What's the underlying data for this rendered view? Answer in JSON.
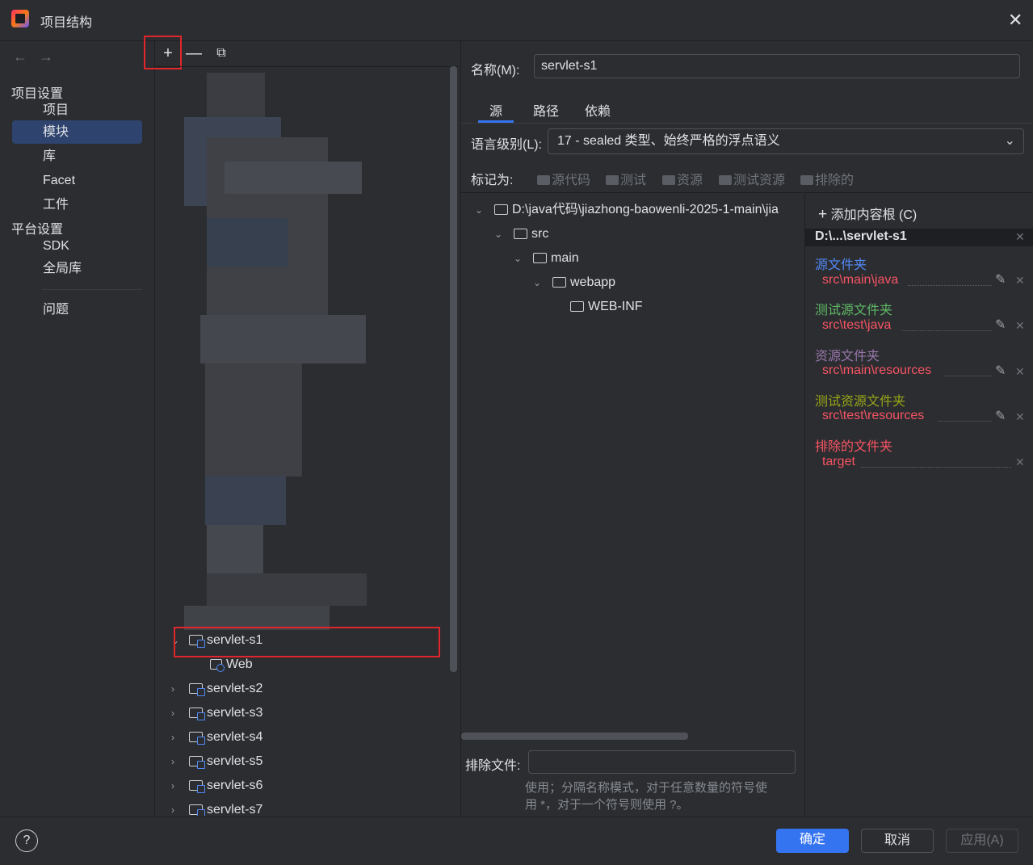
{
  "window": {
    "title": "项目结构"
  },
  "sidebar": {
    "project_settings": "项目设置",
    "items": [
      {
        "label": "项目"
      },
      {
        "label": "模块",
        "selected": true
      },
      {
        "label": "库"
      },
      {
        "label": "Facet"
      },
      {
        "label": "工件"
      }
    ],
    "platform_settings": "平台设置",
    "platform_items": [
      {
        "label": "SDK"
      },
      {
        "label": "全局库"
      }
    ],
    "problems": "问题"
  },
  "tree": {
    "modules": [
      {
        "label": "servlet-s1",
        "expanded": true,
        "selected": true
      },
      {
        "label": "Web",
        "child": true
      },
      {
        "label": "servlet-s2"
      },
      {
        "label": "servlet-s3"
      },
      {
        "label": "servlet-s4"
      },
      {
        "label": "servlet-s5"
      },
      {
        "label": "servlet-s6"
      },
      {
        "label": "servlet-s7"
      }
    ]
  },
  "module": {
    "name_label": "名称(M):",
    "name_value": "servlet-s1",
    "tabs": [
      {
        "label": "源",
        "active": true
      },
      {
        "label": "路径"
      },
      {
        "label": "依赖"
      }
    ],
    "language_label": "语言级别(L):",
    "language_value": "17 - sealed 类型、始终严格的浮点语义",
    "mark_as_label": "标记为:",
    "mark_as": [
      "源代码",
      "测试",
      "资源",
      "测试资源",
      "排除的"
    ],
    "file_tree": [
      {
        "label": "D:\\java代码\\jiazhong-baowenli-2025-1-main\\jia"
      },
      {
        "label": "src"
      },
      {
        "label": "main"
      },
      {
        "label": "webapp"
      },
      {
        "label": "WEB-INF"
      }
    ],
    "add_content_root": "添加内容根 (C)",
    "content_root": "D:\\...\\servlet-s1",
    "roots": [
      {
        "category": "源文件夹",
        "path": "src\\main\\java",
        "color": "#548af7"
      },
      {
        "category": "测试源文件夹",
        "path": "src\\test\\java",
        "color": "#5fb865"
      },
      {
        "category": "资源文件夹",
        "path": "src\\main\\resources",
        "color": "#9876aa"
      },
      {
        "category": "测试资源文件夹",
        "path": "src\\test\\resources",
        "color": "#9aa617"
      },
      {
        "category": "排除的文件夹",
        "path": "target",
        "color": "#f75464"
      }
    ],
    "exclude_label": "排除文件:",
    "exclude_value": "",
    "exclude_hint_1": "使用；分隔名称模式，对于任意数量的符号使",
    "exclude_hint_2": "用 *，对于一个符号则使用 ?。"
  },
  "footer": {
    "ok": "确定",
    "cancel": "取消",
    "apply": "应用(A)",
    "help": "?"
  }
}
